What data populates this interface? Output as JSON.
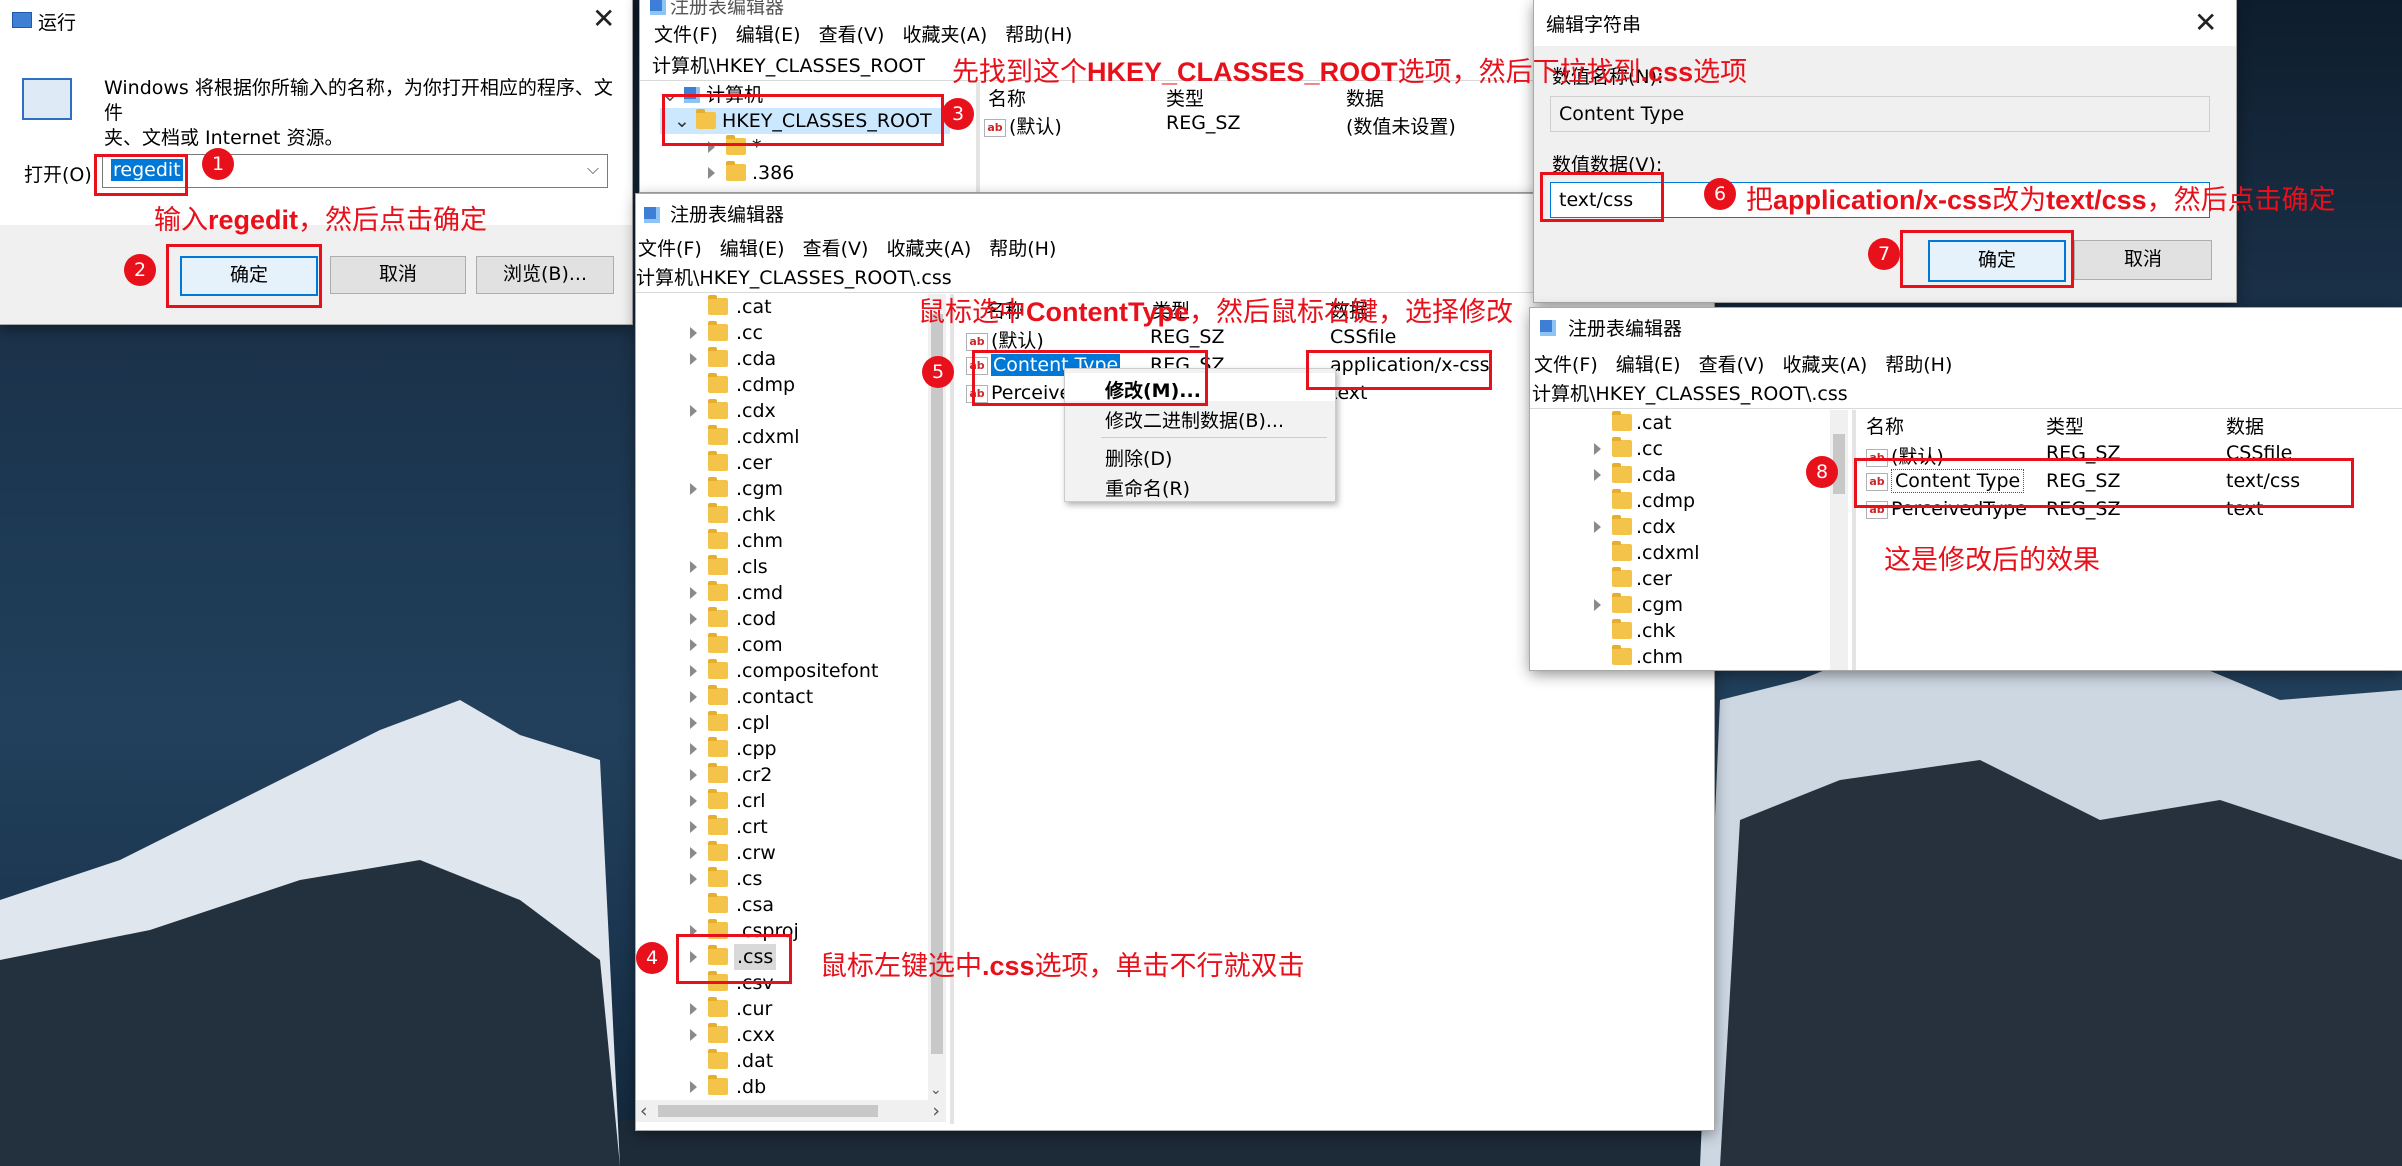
{
  "run_dialog": {
    "title": "运行",
    "description": "Windows 将根据你所输入的名称，为你打开相应的程序、文件夹、文档或 Internet 资源。",
    "desc_line1": "Windows 将根据你所输入的名称，为你打开相应的程序、文件",
    "desc_line2": "夹、文档或 Internet 资源。",
    "open_label": "打开(O):",
    "open_value": "regedit",
    "ok_label": "确定",
    "cancel_label": "取消",
    "browse_label": "浏览(B)..."
  },
  "reg_top": {
    "title": "注册表编辑器",
    "menu": [
      "文件(F)",
      "编辑(E)",
      "查看(V)",
      "收藏夹(A)",
      "帮助(H)"
    ],
    "address": "计算机\\HKEY_CLASSES_ROOT",
    "tree": [
      "计算机",
      "HKEY_CLASSES_ROOT",
      "*",
      ".386"
    ],
    "columns": [
      "名称",
      "类型",
      "数据"
    ],
    "row": {
      "name": "(默认)",
      "type": "REG_SZ",
      "data": "(数值未设置)"
    }
  },
  "reg_main": {
    "title": "注册表编辑器",
    "menu": [
      "文件(F)",
      "编辑(E)",
      "查看(V)",
      "收藏夹(A)",
      "帮助(H)"
    ],
    "address": "计算机\\HKEY_CLASSES_ROOT\\.css",
    "tree": [
      ".cat",
      ".cc",
      ".cda",
      ".cdmp",
      ".cdx",
      ".cdxml",
      ".cer",
      ".cgm",
      ".chk",
      ".chm",
      ".cls",
      ".cmd",
      ".cod",
      ".com",
      ".compositefont",
      ".contact",
      ".cpl",
      ".cpp",
      ".cr2",
      ".crl",
      ".crt",
      ".crw",
      ".cs",
      ".csa",
      ".csproj",
      ".css",
      ".csv",
      ".cur",
      ".cxx",
      ".dat",
      ".db"
    ],
    "columns": [
      "名称",
      "类型",
      "数据"
    ],
    "rows": [
      {
        "name": "(默认)",
        "type": "REG_SZ",
        "data": "CSSfile"
      },
      {
        "name": "Content Type",
        "type": "REG_SZ",
        "data": "application/x-css"
      },
      {
        "name": "PerceivedType",
        "type": "REG_SZ",
        "data": "text"
      }
    ],
    "context_menu": [
      "修改(M)...",
      "修改二进制数据(B)...",
      "删除(D)",
      "重命名(R)"
    ]
  },
  "edit_dialog": {
    "title": "编辑字符串",
    "name_label": "数值名称(N):",
    "name_value": "Content Type",
    "data_label": "数值数据(V):",
    "data_value": "text/css",
    "ok_label": "确定",
    "cancel_label": "取消"
  },
  "reg_result": {
    "title": "注册表编辑器",
    "menu": [
      "文件(F)",
      "编辑(E)",
      "查看(V)",
      "收藏夹(A)",
      "帮助(H)"
    ],
    "address": "计算机\\HKEY_CLASSES_ROOT\\.css",
    "tree": [
      ".cat",
      ".cc",
      ".cda",
      ".cdmp",
      ".cdx",
      ".cdxml",
      ".cer",
      ".cgm",
      ".chk",
      ".chm"
    ],
    "columns": [
      "名称",
      "类型",
      "数据"
    ],
    "rows": [
      {
        "name": "(默认)",
        "type": "REG_SZ",
        "data": "CSSfile"
      },
      {
        "name": "Content Type",
        "type": "REG_SZ",
        "data": "text/css"
      },
      {
        "name": "PerceivedType",
        "type": "REG_SZ",
        "data": "text"
      }
    ]
  },
  "annotations": {
    "n1": "1",
    "n2": "2",
    "n3": "3",
    "n4": "4",
    "n5": "5",
    "n6": "6",
    "n7": "7",
    "n8": "8",
    "step1_pre": "输入",
    "step1_bold": "regedit",
    "step1_post": "，然后点击确定",
    "step3_pre": "先找到这个",
    "step3_bold": "HKEY_CLASSES_ROOT",
    "step3_mid": "选项，然后下拉找到",
    "step3_bold2": ".css",
    "step3_post": "选项",
    "step4_pre": "鼠标左键选中",
    "step4_bold": ".css",
    "step4_post": "选项，单击不行就双击",
    "step5_pre": "鼠标选中",
    "step5_bold": "ContentType",
    "step5_post": "，然后鼠标右键，选择修改",
    "step6_pre": "把",
    "step6_bold": "application/x-css",
    "step6_mid": "改为",
    "step6_bold2": "text/css",
    "step6_post": "，然后点击确定",
    "step8": "这是修改后的效果"
  },
  "colors": {
    "annotation_red": "#e8101a",
    "selection_blue": "#0078d7",
    "folder_yellow": "#f3c34a"
  }
}
